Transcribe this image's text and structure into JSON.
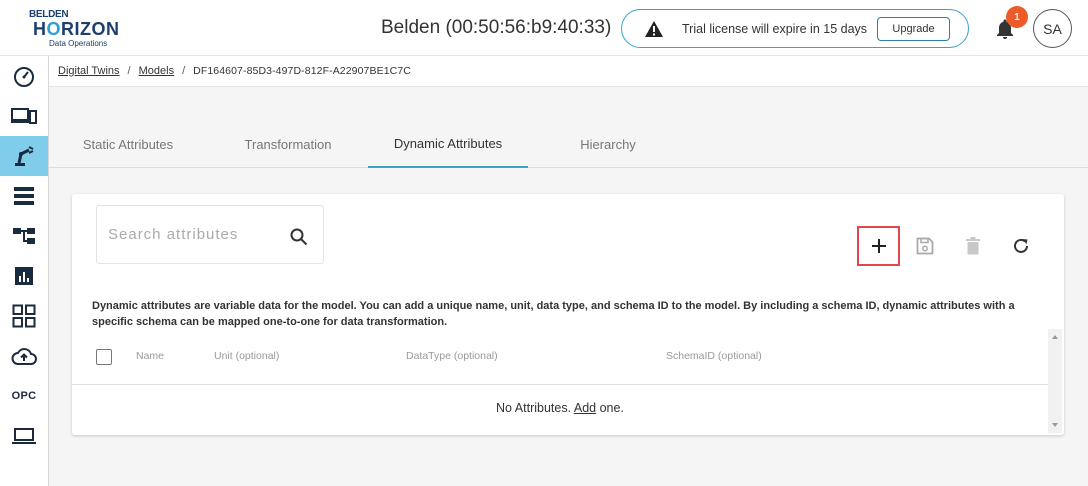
{
  "logo": {
    "line1": "BELDEN",
    "line2_a": "H",
    "line2_o": "O",
    "line2_b": "RIZON",
    "line3": "Data Operations"
  },
  "header": {
    "device_title": "Belden (00:50:56:b9:40:33)",
    "trial_message": "Trial license will expire in 15 days",
    "upgrade_label": "Upgrade",
    "notification_count": "1",
    "avatar_initials": "SA"
  },
  "sidebar": {
    "items": [
      {
        "icon": "dashboard-gauge-icon"
      },
      {
        "icon": "devices-icon"
      },
      {
        "icon": "robot-arm-icon",
        "active": true
      },
      {
        "icon": "server-list-icon"
      },
      {
        "icon": "hierarchy-icon"
      },
      {
        "icon": "bar-chart-icon"
      },
      {
        "icon": "apps-grid-icon"
      },
      {
        "icon": "cloud-upload-icon"
      },
      {
        "icon": "opc-icon",
        "label": "OPC"
      },
      {
        "icon": "laptop-icon"
      }
    ]
  },
  "breadcrumb": {
    "items": [
      "Digital Twins",
      "Models"
    ],
    "separator": "/",
    "current": "DF164607-85D3-497D-812F-A22907BE1C7C"
  },
  "tabs": [
    {
      "label": "Static Attributes",
      "active": false
    },
    {
      "label": "Transformation",
      "active": false
    },
    {
      "label": "Dynamic Attributes",
      "active": true
    },
    {
      "label": "Hierarchy",
      "active": false
    }
  ],
  "search": {
    "placeholder": "Search attributes",
    "value": ""
  },
  "toolbar": {
    "add": "add-icon",
    "save": "save-icon",
    "delete": "delete-icon",
    "refresh": "refresh-icon"
  },
  "description": "Dynamic attributes are variable data for the model. You can add a unique name, unit, data type, and schema ID to the model. By including a schema ID, dynamic attributes with a specific schema can be mapped one-to-one for data transformation.",
  "table": {
    "columns": [
      "Name",
      "Unit (optional)",
      "DataType (optional)",
      "SchemaID (optional)"
    ],
    "empty_prefix": "No Attributes.",
    "empty_link": "Add",
    "empty_suffix": "one."
  },
  "colors": {
    "accent": "#3aa0cf",
    "sidebar_active": "#7fcdea",
    "badge": "#ef5a29",
    "highlight": "#e0464a",
    "brand": "#1d3f6e"
  }
}
